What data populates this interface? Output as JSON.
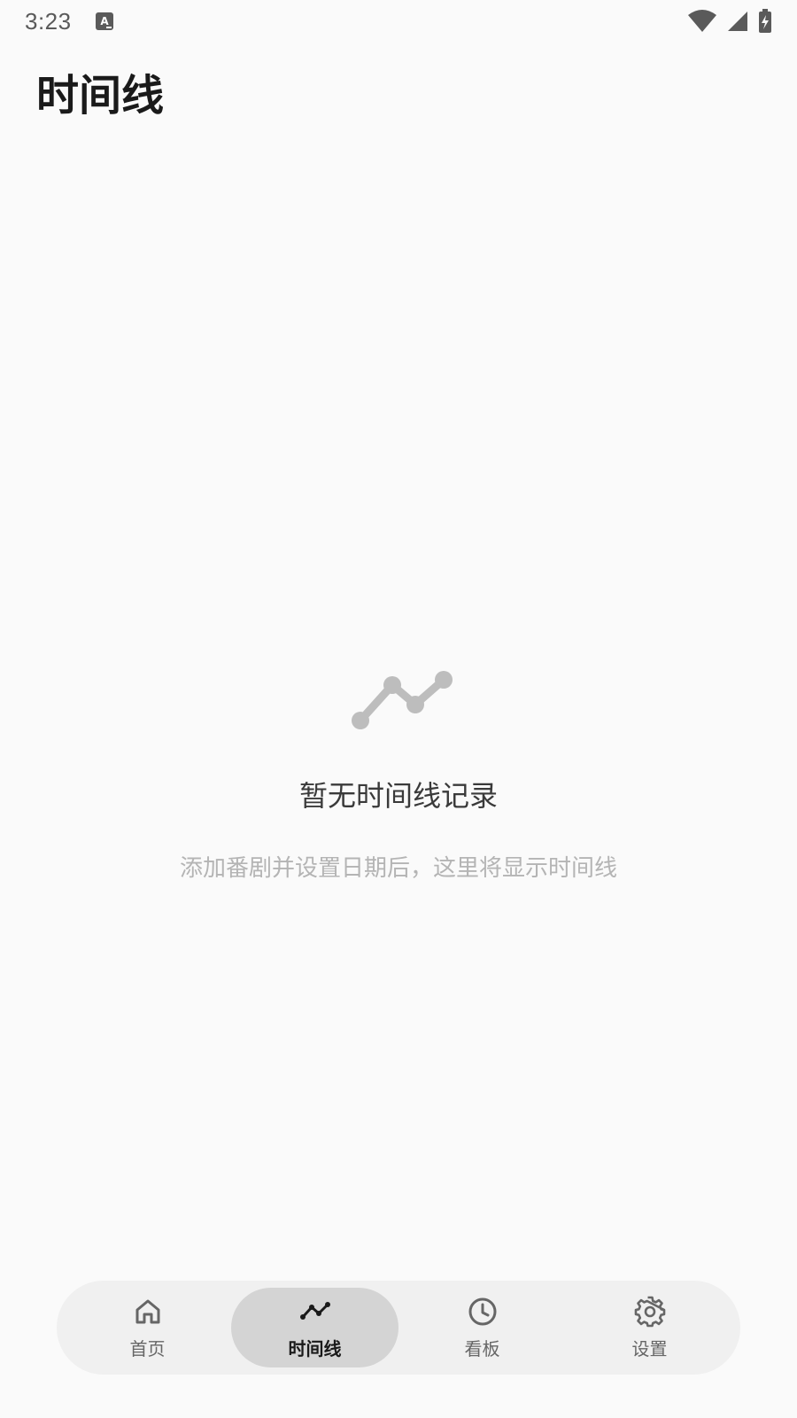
{
  "status_bar": {
    "time": "3:23",
    "notification_icon": "keyboard-a-icon",
    "wifi_icon": "wifi-icon",
    "signal_icon": "cell-signal-icon",
    "battery_icon": "battery-charging-icon"
  },
  "header": {
    "title": "时间线"
  },
  "empty_state": {
    "icon": "timeline-chart-icon",
    "title": "暂无时间线记录",
    "subtitle": "添加番剧并设置日期后，这里将显示时间线"
  },
  "bottom_nav": {
    "items": [
      {
        "label": "首页",
        "icon": "home-icon",
        "active": false
      },
      {
        "label": "时间线",
        "icon": "timeline-icon",
        "active": true
      },
      {
        "label": "看板",
        "icon": "clock-icon",
        "active": false
      },
      {
        "label": "设置",
        "icon": "gear-icon",
        "active": false
      }
    ]
  },
  "colors": {
    "background": "#fafafa",
    "nav_background": "#f0f0f0",
    "nav_active": "#d4d4d4",
    "empty_icon": "#bdbdbd",
    "subtitle": "#b4b4b4"
  }
}
